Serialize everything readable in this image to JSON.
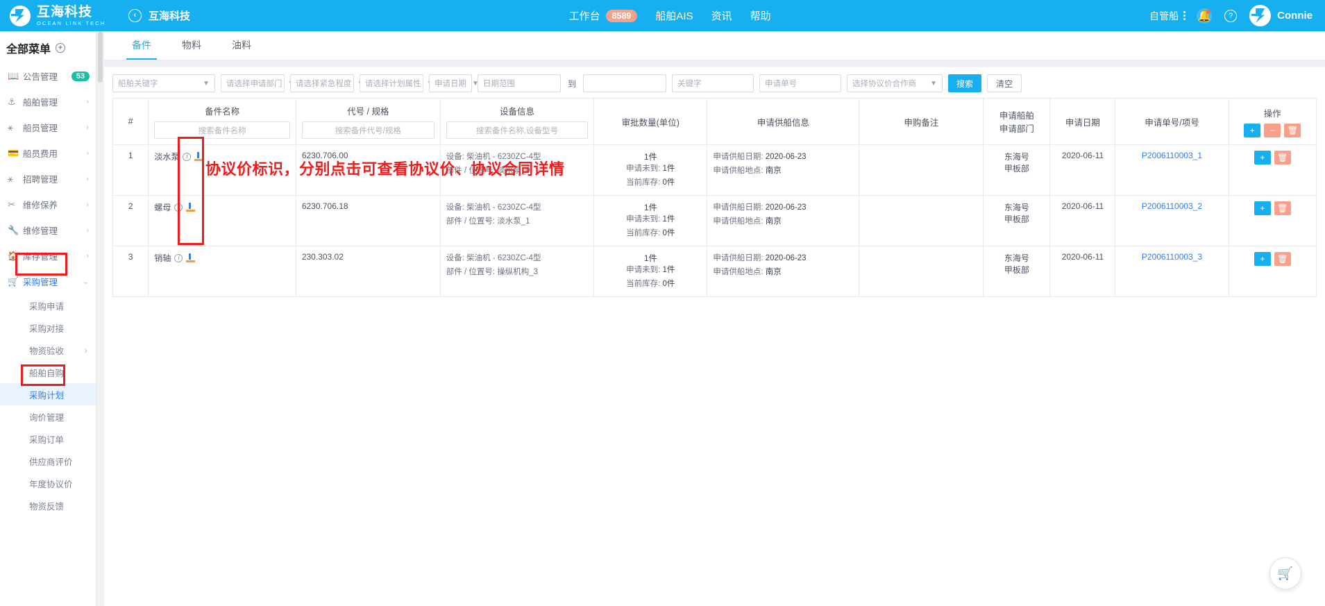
{
  "topbar": {
    "brand_cn": "互海科技",
    "brand_en": "OCEAN LINK TECH",
    "back_label": "互海科技",
    "nav": [
      {
        "label": "工作台",
        "badge": "8589"
      },
      {
        "label": "船舶AIS",
        "badge": ""
      },
      {
        "label": "资讯",
        "badge": ""
      },
      {
        "label": "帮助",
        "badge": ""
      }
    ],
    "ship_selector": "自管船",
    "username": "Connie"
  },
  "sidebar": {
    "title": "全部菜单",
    "items": [
      {
        "label": "公告管理",
        "icon": "announcement-icon",
        "badge": "53",
        "chevron": false
      },
      {
        "label": "船舶管理",
        "icon": "anchor-icon",
        "badge": "",
        "chevron": true
      },
      {
        "label": "船员管理",
        "icon": "crew-icon",
        "badge": "",
        "chevron": true
      },
      {
        "label": "船员费用",
        "icon": "expense-icon",
        "badge": "",
        "chevron": true
      },
      {
        "label": "招聘管理",
        "icon": "recruit-icon",
        "badge": "",
        "chevron": true
      },
      {
        "label": "维修保养",
        "icon": "maintenance-icon",
        "badge": "",
        "chevron": true
      },
      {
        "label": "维修管理",
        "icon": "wrench-icon",
        "badge": "",
        "chevron": true
      },
      {
        "label": "库存管理",
        "icon": "warehouse-icon",
        "badge": "",
        "chevron": true
      },
      {
        "label": "采购管理",
        "icon": "cart-icon",
        "badge": "",
        "chevron": true,
        "active": true
      }
    ],
    "subitems": [
      {
        "label": "采购申请",
        "chevron": false
      },
      {
        "label": "采购对接",
        "chevron": false
      },
      {
        "label": "物资验收",
        "chevron": true
      },
      {
        "label": "船舶自购",
        "chevron": false
      },
      {
        "label": "采购计划",
        "chevron": false,
        "current": true
      },
      {
        "label": "询价管理",
        "chevron": false
      },
      {
        "label": "采购订单",
        "chevron": false
      },
      {
        "label": "供应商评价",
        "chevron": false
      },
      {
        "label": "年度协议价",
        "chevron": false
      },
      {
        "label": "物资反馈",
        "chevron": false
      }
    ]
  },
  "tabs": [
    {
      "label": "备件",
      "selected": true
    },
    {
      "label": "物料",
      "selected": false
    },
    {
      "label": "油料",
      "selected": false
    }
  ],
  "filters": {
    "ship_keyword": "船舶关键字",
    "dept": "请选择申请部门",
    "urgency": "请选择紧急程度",
    "plan_attr": "请选择计划属性",
    "apply_date": "申请日期",
    "date_range_from": "日期范围",
    "date_range_to": "",
    "to_label": "到",
    "keyword": "关键字",
    "apply_no": "申请单号",
    "coop": "选择协议价合作商",
    "search_button": "搜索",
    "clear_button": "清空"
  },
  "table": {
    "headers": {
      "index": "#",
      "name": "备件名称",
      "name_search": "搜索备件名称",
      "code": "代号 / 规格",
      "code_search": "搜索备件代号/规格",
      "equipment": "设备信息",
      "equipment_search": "搜索备件名称,设备型号",
      "approved_qty": "审批数量(单位)",
      "supply_info": "申请供船信息",
      "purchase_note": "申购备注",
      "ship_dept": "申请船舶\n申请部门",
      "ship_dept_line1": "申请船舶",
      "ship_dept_line2": "申请部门",
      "apply_date": "申请日期",
      "apply_no": "申请单号/项号",
      "operation": "操作"
    },
    "rows": [
      {
        "index": "1",
        "name": "淡水泵",
        "code": "6230.706.00",
        "equipment_line1": "设备: 柴油机 - 6230ZC-4型",
        "equipment_line2": "部件 / 位置号: 淡水泵_0",
        "qty_main": "1件",
        "qty_pending_label": "申请未到:",
        "qty_pending": "1件",
        "qty_stock_label": "当前库存:",
        "qty_stock": "0件",
        "supply_date_label": "申请供船日期:",
        "supply_date": "2020-06-23",
        "supply_place_label": "申请供船地点:",
        "supply_place": "南京",
        "purchase_note": "",
        "ship": "东海号",
        "dept": "甲板部",
        "apply_date": "2020-06-11",
        "apply_no": "P2006110003_1"
      },
      {
        "index": "2",
        "name": "螺母",
        "code": "6230.706.18",
        "equipment_line1": "设备: 柴油机 - 6230ZC-4型",
        "equipment_line2": "部件 / 位置号: 淡水泵_1",
        "qty_main": "1件",
        "qty_pending_label": "申请未到:",
        "qty_pending": "1件",
        "qty_stock_label": "当前库存:",
        "qty_stock": "0件",
        "supply_date_label": "申请供船日期:",
        "supply_date": "2020-06-23",
        "supply_place_label": "申请供船地点:",
        "supply_place": "南京",
        "purchase_note": "",
        "ship": "东海号",
        "dept": "甲板部",
        "apply_date": "2020-06-11",
        "apply_no": "P2006110003_2"
      },
      {
        "index": "3",
        "name": "销轴",
        "code": "230.303.02",
        "equipment_line1": "设备: 柴油机 - 6230ZC-4型",
        "equipment_line2": "部件 / 位置号: 操纵机构_3",
        "qty_main": "1件",
        "qty_pending_label": "申请未到:",
        "qty_pending": "1件",
        "qty_stock_label": "当前库存:",
        "qty_stock": "0件",
        "supply_date_label": "申请供船日期:",
        "supply_date": "2020-06-23",
        "supply_place_label": "申请供船地点:",
        "supply_place": "南京",
        "purchase_note": "",
        "ship": "东海号",
        "dept": "甲板部",
        "apply_date": "2020-06-11",
        "apply_no": "P2006110003_3"
      }
    ]
  },
  "annotation": {
    "text": "协议价标识，分别点击可查看协议价、协议合同详情",
    "color": "#ee1c1c"
  },
  "colors": {
    "brand_blue": "#16aff0",
    "link_blue": "#2f7bf6",
    "accent_orange": "#f8a08a",
    "badge_green": "#13c2a4",
    "annotation_red": "#ee1c1c"
  }
}
